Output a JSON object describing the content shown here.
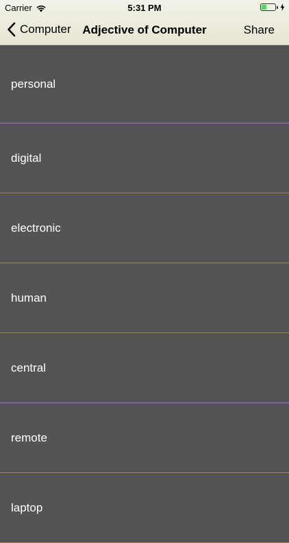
{
  "status_bar": {
    "carrier": "Carrier",
    "time": "5:31 PM",
    "battery_level": 0.35,
    "battery_color": "#4cd964"
  },
  "nav": {
    "back_label": "Computer",
    "title": "Adjective of Computer",
    "share_label": "Share",
    "back_icon": "chevron-left-icon"
  },
  "colors": {
    "background": "#545454",
    "separator": "#9d8b46",
    "item_text": "#ffffff",
    "navbar": "#ecebdb"
  },
  "list": {
    "items": [
      {
        "label": "personal"
      },
      {
        "label": "digital"
      },
      {
        "label": "electronic"
      },
      {
        "label": "human"
      },
      {
        "label": "central"
      },
      {
        "label": "remote"
      },
      {
        "label": "laptop"
      }
    ]
  }
}
